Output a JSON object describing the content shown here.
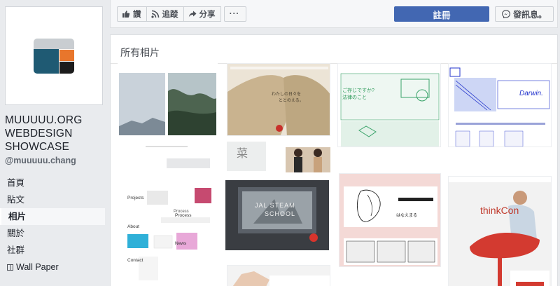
{
  "page": {
    "name_lines": [
      "MUUUUU.ORG",
      "WEBDESIGN",
      "SHOWCASE"
    ],
    "handle": "@muuuuu.chang"
  },
  "nav": {
    "items": [
      {
        "label": "首頁",
        "active": false
      },
      {
        "label": "貼文",
        "active": false
      },
      {
        "label": "相片",
        "active": true
      },
      {
        "label": "關於",
        "active": false
      },
      {
        "label": "社群",
        "active": false
      },
      {
        "label": "Wall Paper",
        "active": false,
        "icon": "wallpaper-icon"
      }
    ]
  },
  "actions": {
    "like_label": "讚",
    "follow_label": "追蹤",
    "share_label": "分享",
    "more_label": "···",
    "signup_label": "註冊",
    "message_label": "發訊息。"
  },
  "photos": {
    "title": "所有相片",
    "thumbs": [
      {
        "name": "photo-thumb-mountains",
        "texts": [
          "Process"
        ]
      },
      {
        "name": "photo-thumb-coat",
        "texts": [
          "わたしの日々を",
          "ととのえる。"
        ]
      },
      {
        "name": "photo-thumb-green-legal",
        "texts": [
          "ご存じですか?",
          "法律のこと"
        ]
      },
      {
        "name": "photo-thumb-darwin",
        "texts": [
          "Darwin."
        ]
      },
      {
        "name": "photo-thumb-design-list",
        "texts": [
          "Projects",
          "Process",
          "About",
          "News",
          "Contact"
        ]
      },
      {
        "name": "photo-thumb-people",
        "texts": [
          "菜"
        ]
      },
      {
        "name": "photo-thumb-steam-school",
        "texts": [
          "JAL STEAM",
          "SCHOOL"
        ]
      },
      {
        "name": "photo-thumb-manga",
        "texts": [
          "はなえまる"
        ]
      },
      {
        "name": "photo-thumb-chair",
        "texts": [
          "thinkCon"
        ]
      },
      {
        "name": "photo-thumb-hand",
        "texts": []
      }
    ]
  },
  "colors": {
    "primary": "#4267b2",
    "background": "#e9ebee",
    "logo_blue": "#1f5a73",
    "logo_orange": "#e8762c"
  }
}
